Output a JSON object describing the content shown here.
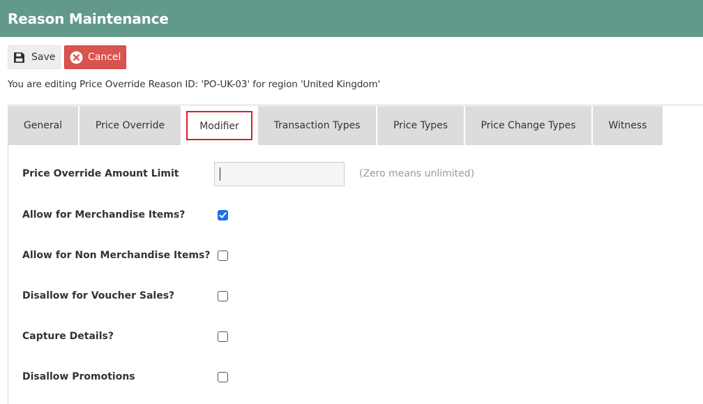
{
  "header": {
    "title": "Reason Maintenance"
  },
  "toolbar": {
    "save_label": "Save",
    "cancel_label": "Cancel"
  },
  "edit_info": "You are editing Price Override Reason ID: 'PO-UK-03' for region 'United Kingdom'",
  "tabs": [
    {
      "label": "General",
      "active": false
    },
    {
      "label": "Price Override",
      "active": false
    },
    {
      "label": "Modifier",
      "active": true
    },
    {
      "label": "Transaction Types",
      "active": false
    },
    {
      "label": "Price Types",
      "active": false
    },
    {
      "label": "Price Change Types",
      "active": false
    },
    {
      "label": "Witness",
      "active": false
    }
  ],
  "form": {
    "amount_limit": {
      "label": "Price Override Amount Limit",
      "value": "",
      "hint": "(Zero means unlimited)"
    },
    "checkboxes": [
      {
        "label": "Allow for Merchandise Items?",
        "checked": true
      },
      {
        "label": "Allow for Non Merchandise Items?",
        "checked": false
      },
      {
        "label": "Disallow for Voucher Sales?",
        "checked": false
      },
      {
        "label": "Capture Details?",
        "checked": false
      },
      {
        "label": "Disallow Promotions",
        "checked": false
      }
    ]
  },
  "colors": {
    "header_bg": "#62998a",
    "cancel_bg": "#d9534f",
    "active_tab_outline": "#d42127",
    "checkbox_checked": "#1a73e8"
  },
  "icons": {
    "save": "floppy-disk-icon",
    "cancel": "x-circle-icon",
    "check": "checkmark-icon"
  }
}
